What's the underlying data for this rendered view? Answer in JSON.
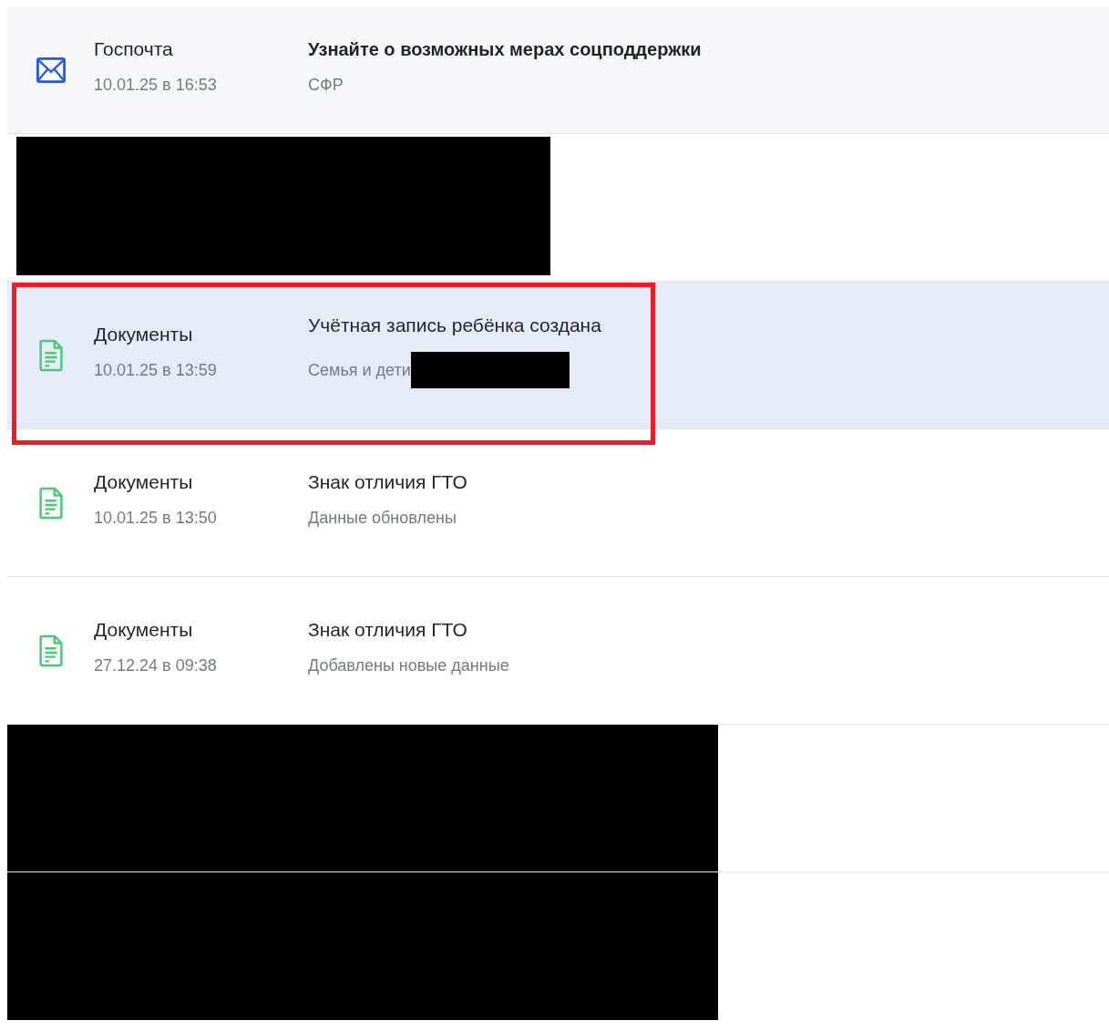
{
  "notifications": [
    {
      "kind": "mail",
      "source": "Госпочта",
      "time": "10.01.25 в 16:53",
      "title": "Узнайте о возможных мерах соцподдержки",
      "title_bold": true,
      "subtitle": "СФР",
      "selected": false,
      "marked": false,
      "redacted_suffix": false
    },
    {
      "kind": "redacted"
    },
    {
      "kind": "document",
      "source": "Документы",
      "time": "10.01.25 в 13:59",
      "title": "Учётная запись ребёнка создана",
      "title_bold": false,
      "subtitle": "Семья и дети",
      "selected": true,
      "marked": true,
      "redacted_suffix": true
    },
    {
      "kind": "document",
      "source": "Документы",
      "time": "10.01.25 в 13:50",
      "title": "Знак отличия ГТО",
      "title_bold": false,
      "subtitle": "Данные обновлены",
      "selected": false,
      "marked": false,
      "redacted_suffix": false
    },
    {
      "kind": "document",
      "source": "Документы",
      "time": "27.12.24 в 09:38",
      "title": "Знак отличия ГТО",
      "title_bold": false,
      "subtitle": "Добавлены новые данные",
      "selected": false,
      "marked": false,
      "redacted_suffix": false
    },
    {
      "kind": "blackout"
    },
    {
      "kind": "blackout"
    }
  ]
}
